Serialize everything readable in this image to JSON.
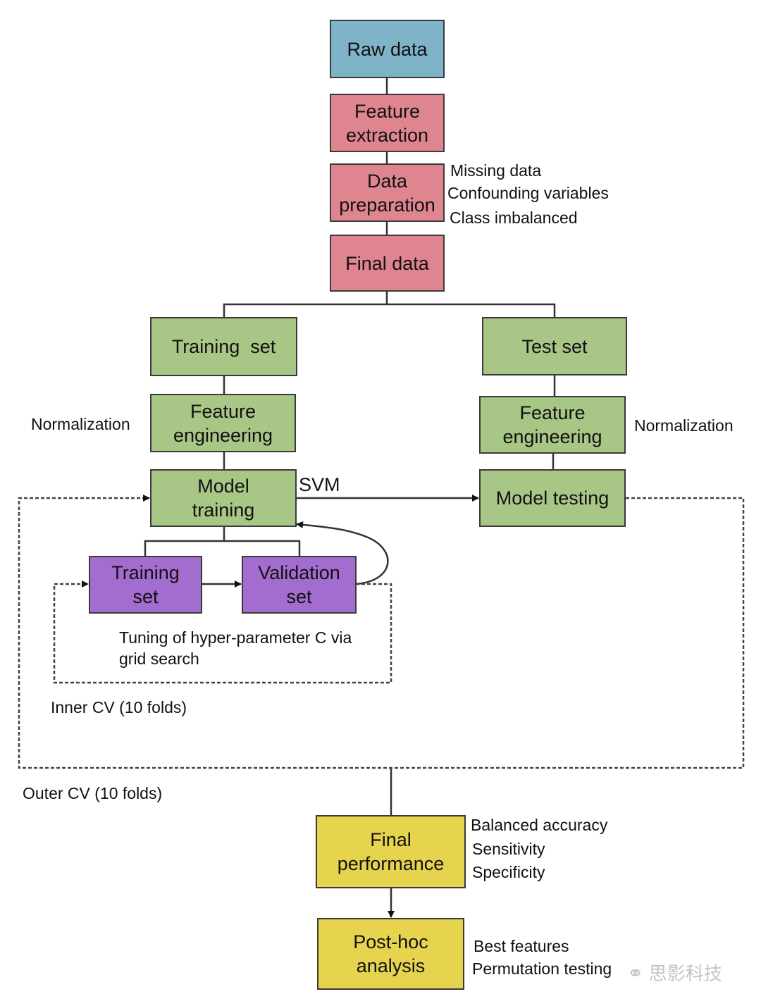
{
  "nodes": {
    "raw_data": "Raw data",
    "feature_extraction": [
      "Feature",
      "extraction"
    ],
    "data_preparation": [
      "Data",
      "preparation"
    ],
    "final_data": "Final data",
    "training_set": "Training  set",
    "test_set": "Test set",
    "feature_engineering_left": [
      "Feature",
      "engineering"
    ],
    "feature_engineering_right": [
      "Feature",
      "engineering"
    ],
    "model_training": [
      "Model",
      "training"
    ],
    "model_testing": "Model testing",
    "inner_training_set": [
      "Training",
      "set"
    ],
    "validation_set": [
      "Validation",
      "set"
    ],
    "final_performance": [
      "Final",
      "performance"
    ],
    "post_hoc_analysis": [
      "Post-hoc",
      "analysis"
    ]
  },
  "annotations": {
    "data_prep_notes": [
      "Missing data",
      "Confounding variables",
      "Class imbalanced"
    ],
    "normalization_left": "Normalization",
    "normalization_right": "Normalization",
    "svm": "SVM",
    "tuning": [
      "Tuning of hyper-parameter C via",
      "grid search"
    ],
    "inner_cv": "Inner CV (10 folds)",
    "outer_cv": "Outer CV (10 folds)",
    "performance_metrics": [
      "Balanced accuracy",
      "Sensitivity",
      "Specificity"
    ],
    "post_hoc_items": [
      "Best features",
      "Permutation testing"
    ]
  },
  "watermark": "思影科技",
  "colors": {
    "raw": "#7fb3c8",
    "preprocessing": "#df858f",
    "modeling": "#a8c685",
    "inner_cv": "#a36ccf",
    "results": "#e6d34e"
  }
}
